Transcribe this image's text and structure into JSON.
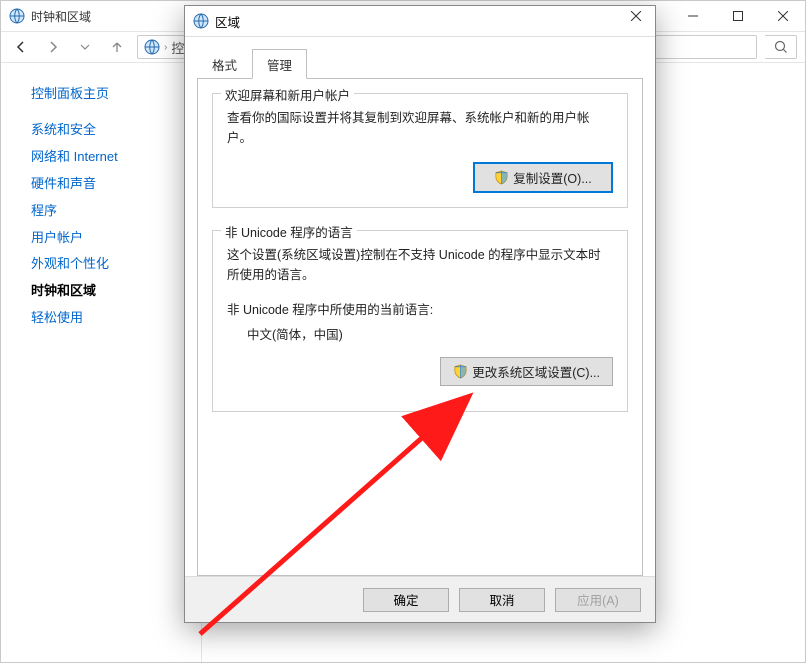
{
  "parent_window": {
    "title": "时钟和区域",
    "nav": {
      "breadcrumb_label": "控制"
    },
    "sidebar": {
      "home": "控制面板主页",
      "items": [
        {
          "label": "系统和安全",
          "current": false
        },
        {
          "label": "网络和 Internet",
          "current": false
        },
        {
          "label": "硬件和声音",
          "current": false
        },
        {
          "label": "程序",
          "current": false
        },
        {
          "label": "用户帐户",
          "current": false
        },
        {
          "label": "外观和个性化",
          "current": false
        },
        {
          "label": "时钟和区域",
          "current": true
        },
        {
          "label": "轻松使用",
          "current": false
        }
      ]
    }
  },
  "dialog": {
    "title": "区域",
    "tabs": {
      "format": "格式",
      "admin": "管理"
    },
    "active_tab": "admin",
    "group1": {
      "legend": "欢迎屏幕和新用户帐户",
      "desc": "查看你的国际设置并将其复制到欢迎屏幕、系统帐户和新的用户帐户。",
      "button": "复制设置(O)..."
    },
    "group2": {
      "legend": "非 Unicode 程序的语言",
      "desc": "这个设置(系统区域设置)控制在不支持 Unicode 的程序中显示文本时所使用的语言。",
      "current_label": "非 Unicode 程序中所使用的当前语言:",
      "current_lang": "中文(简体，中国)",
      "button": "更改系统区域设置(C)..."
    },
    "footer": {
      "ok": "确定",
      "cancel": "取消",
      "apply": "应用(A)"
    }
  }
}
